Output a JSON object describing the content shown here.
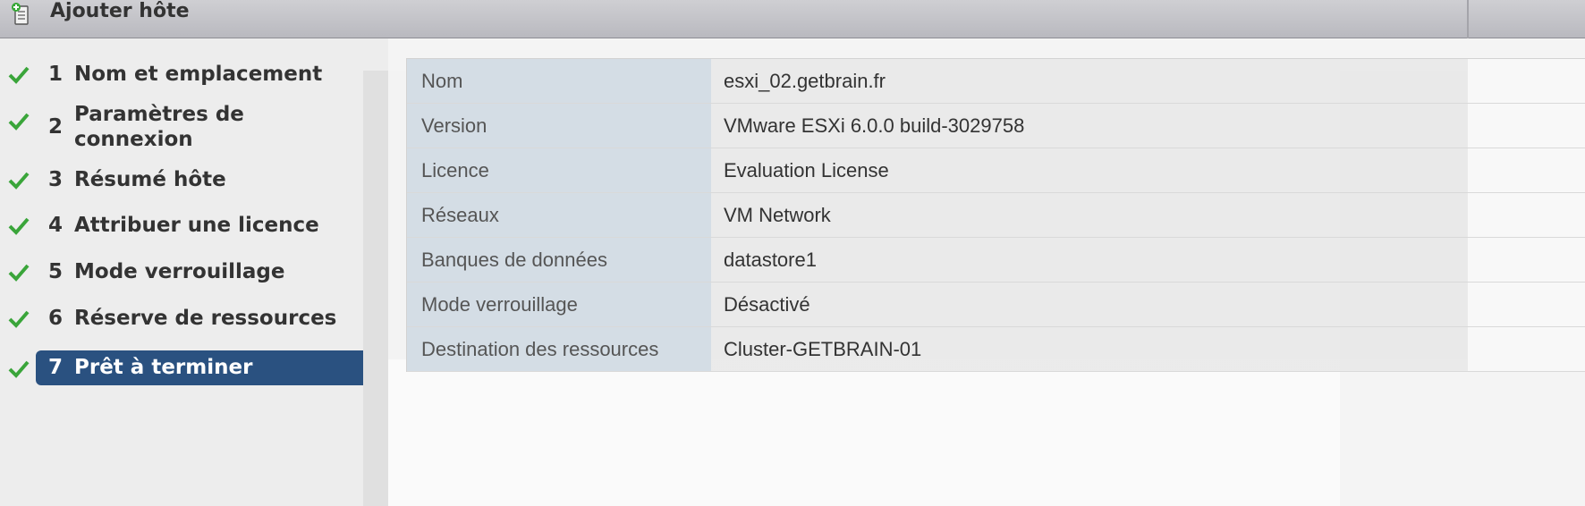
{
  "window": {
    "title": "Ajouter hôte",
    "icon": "add-host-icon"
  },
  "steps": [
    {
      "num": "1",
      "label": "Nom et emplacement",
      "done": true
    },
    {
      "num": "2",
      "label": "Paramètres de connexion",
      "done": true
    },
    {
      "num": "3",
      "label": "Résumé hôte",
      "done": true
    },
    {
      "num": "4",
      "label": "Attribuer une licence",
      "done": true
    },
    {
      "num": "5",
      "label": "Mode verrouillage",
      "done": true
    },
    {
      "num": "6",
      "label": "Réserve de ressources",
      "done": true
    },
    {
      "num": "7",
      "label": "Prêt à terminer",
      "done": true,
      "active": true
    }
  ],
  "summary": [
    {
      "key": "Nom",
      "value": "esxi_02.getbrain.fr"
    },
    {
      "key": "Version",
      "value": "VMware ESXi 6.0.0 build-3029758"
    },
    {
      "key": "Licence",
      "value": "Evaluation License"
    },
    {
      "key": "Réseaux",
      "value": "VM Network"
    },
    {
      "key": "Banques de données",
      "value": "datastore1"
    },
    {
      "key": "Mode verrouillage",
      "value": "Désactivé"
    },
    {
      "key": "Destination des ressources",
      "value": "Cluster-GETBRAIN-01"
    }
  ],
  "colors": {
    "active_step": "#2a5180",
    "check": "#3aa53a",
    "key_cell": "#d4dde5"
  }
}
